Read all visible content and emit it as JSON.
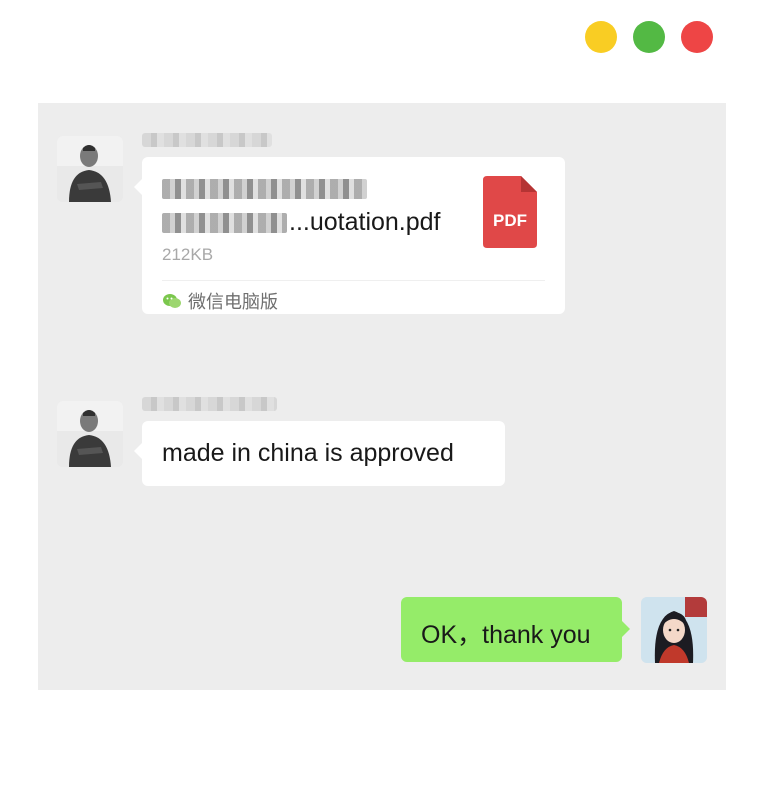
{
  "window": {
    "controls": [
      "minimize-dot",
      "maximize-dot",
      "close-dot"
    ],
    "colors": {
      "yellow": "#f9cd23",
      "green": "#53b944",
      "red": "#ee4545"
    }
  },
  "chat": {
    "background": "#ededed",
    "messages": [
      {
        "side": "left",
        "type": "file",
        "file": {
          "name_suffix": "...uotation.pdf",
          "size": "212KB",
          "icon_label": "PDF",
          "source": "微信电脑版"
        }
      },
      {
        "side": "left",
        "type": "text",
        "text": "made in china is approved"
      },
      {
        "side": "right",
        "type": "text",
        "text": "OK，thank you"
      }
    ]
  },
  "colors": {
    "outgoing_bubble": "#95ec69",
    "incoming_bubble": "#ffffff",
    "pdf_icon": "#e04848"
  }
}
